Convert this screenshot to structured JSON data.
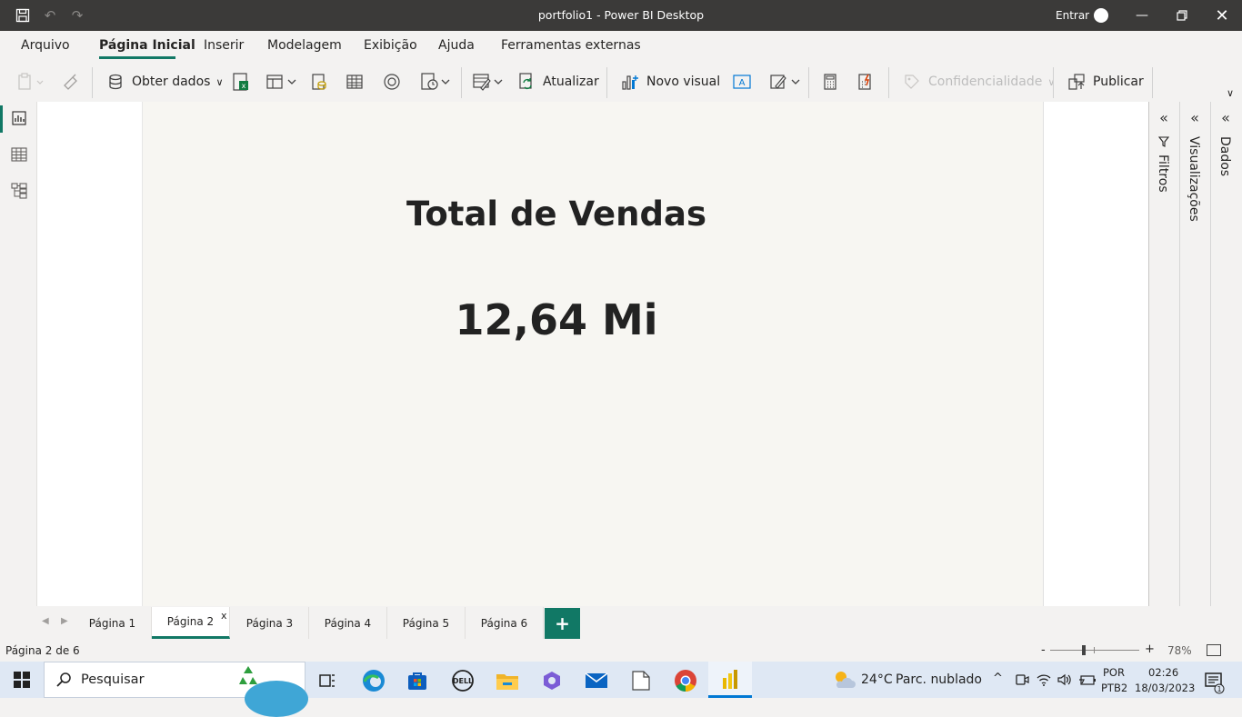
{
  "window": {
    "title": "portfolio1 - Power BI Desktop",
    "signin_label": "Entrar"
  },
  "menu": {
    "tabs": [
      {
        "label": "Arquivo"
      },
      {
        "label": "Página Inicial",
        "active": true
      },
      {
        "label": "Inserir"
      },
      {
        "label": "Modelagem"
      },
      {
        "label": "Exibição"
      },
      {
        "label": "Ajuda"
      },
      {
        "label": "Ferramentas externas"
      }
    ]
  },
  "ribbon": {
    "get_data": "Obter dados",
    "refresh": "Atualizar",
    "new_visual": "Novo visual",
    "sensitivity": "Confidencialidade",
    "publish": "Publicar"
  },
  "report": {
    "card_title": "Total de Vendas",
    "card_value": "12,64 Mi"
  },
  "panes": {
    "filters": "Filtros",
    "visualizations": "Visualizações",
    "data": "Dados"
  },
  "page_tabs": [
    {
      "label": "Página 1"
    },
    {
      "label": "Página 2",
      "active": true
    },
    {
      "label": "Página 3"
    },
    {
      "label": "Página 4"
    },
    {
      "label": "Página 5"
    },
    {
      "label": "Página 6"
    }
  ],
  "status": {
    "page_info": "Página 2 de 6",
    "zoom_level": "78%",
    "zoom_minus": "-",
    "zoom_plus": "+"
  },
  "taskbar": {
    "search_placeholder": "Pesquisar",
    "weather_temp": "24°C",
    "weather_desc": "Parc. nublado",
    "lang_line1": "POR",
    "lang_line2": "PTB2",
    "time": "02:26",
    "date": "18/03/2023"
  },
  "colors": {
    "accent": "#117865",
    "title_bar": "#3b3a39",
    "page_bg": "#f7f6f2"
  }
}
